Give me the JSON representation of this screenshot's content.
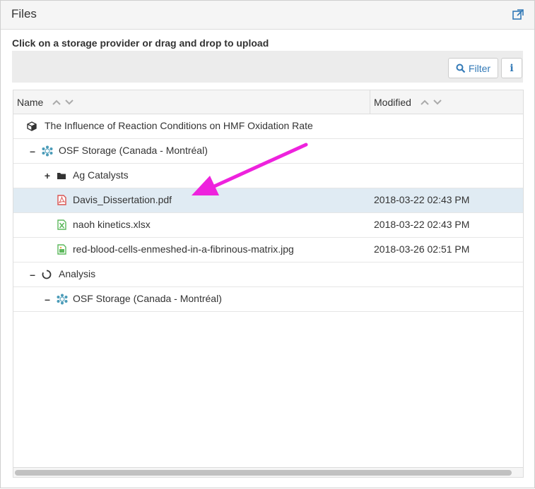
{
  "panel": {
    "title": "Files",
    "upload_hint": "Click on a storage provider or drag and drop to upload"
  },
  "toolbar": {
    "filter_label": "Filter",
    "info_label": "i"
  },
  "columns": {
    "name": "Name",
    "modified": "Modified"
  },
  "tree": [
    {
      "toggle": "",
      "icon": "project-cube-icon",
      "label": "The Influence of Reaction Conditions on HMF Oxidation Rate",
      "modified": ""
    },
    {
      "toggle": "–",
      "icon": "osf-storage-icon",
      "label": "OSF Storage  (Canada - Montréal)",
      "modified": ""
    },
    {
      "toggle": "+",
      "icon": "folder-icon",
      "label": "Ag Catalysts",
      "modified": ""
    },
    {
      "toggle": "",
      "icon": "pdf-file-icon",
      "label": "Davis_Dissertation.pdf",
      "modified": "2018-03-22 02:43 PM"
    },
    {
      "toggle": "",
      "icon": "excel-file-icon",
      "label": "naoh kinetics.xlsx",
      "modified": "2018-03-22 02:43 PM"
    },
    {
      "toggle": "",
      "icon": "image-file-icon",
      "label": "red-blood-cells-enmeshed-in-a-fibrinous-matrix.jpg",
      "modified": "2018-03-26 02:51 PM"
    },
    {
      "toggle": "–",
      "icon": "component-circle-icon",
      "label": "Analysis",
      "modified": ""
    },
    {
      "toggle": "–",
      "icon": "osf-storage-icon",
      "label": "OSF Storage (Canada - Montréal)",
      "modified": ""
    }
  ],
  "colors": {
    "accent_link": "#337ab7",
    "selected_row": "#e0ebf3",
    "annotation_arrow": "#ee22dd",
    "pdf_red": "#d9534f",
    "excel_green": "#5cb85c"
  }
}
